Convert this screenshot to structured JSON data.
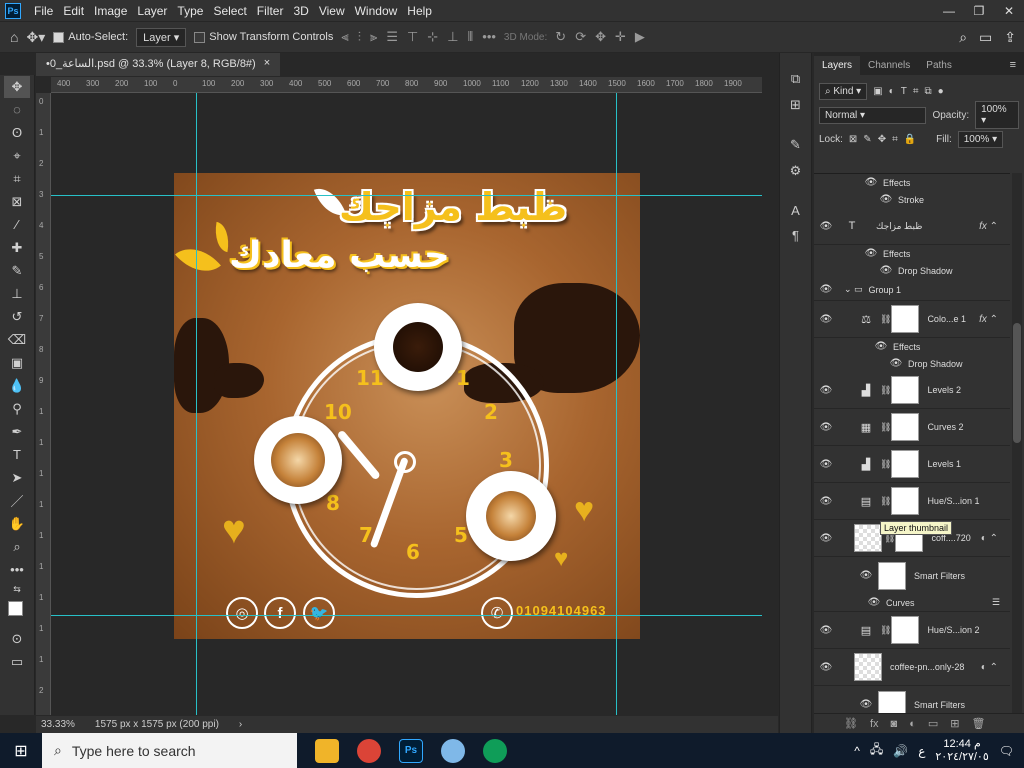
{
  "menubar": {
    "logo": "Ps",
    "items": [
      "File",
      "Edit",
      "Image",
      "Layer",
      "Type",
      "Select",
      "Filter",
      "3D",
      "View",
      "Window",
      "Help"
    ],
    "window_controls": [
      "—",
      "❐",
      "✕"
    ]
  },
  "options": {
    "auto_select_label": "Auto-Select:",
    "auto_select_target": "Layer",
    "show_transform_label": "Show Transform Controls",
    "mode_3d_label": "3D Mode:"
  },
  "document": {
    "tab_title": "•0_الساعة.psd @ 33.3% (Layer 8, RGB/8#)",
    "close": "×"
  },
  "ruler": {
    "h_ticks": [
      "400",
      "300",
      "200",
      "100",
      "0",
      "100",
      "200",
      "300",
      "400",
      "500",
      "600",
      "700",
      "800",
      "900",
      "1000",
      "1100",
      "1200",
      "1300",
      "1400",
      "1500",
      "1600",
      "1700",
      "1800",
      "1900"
    ],
    "v_ticks": [
      "0",
      "1",
      "2",
      "3",
      "4",
      "5",
      "6",
      "7",
      "8",
      "9",
      "1",
      "1",
      "1",
      "1",
      "1",
      "1",
      "1",
      "1",
      "1",
      "2"
    ]
  },
  "artwork": {
    "title_line1": "ظبط مزاجك",
    "title_line2": "حسب معادك",
    "clock_numbers": [
      "11",
      "1",
      "10",
      "2",
      "3",
      "8",
      "7",
      "6",
      "5"
    ],
    "social_icons": [
      "instagram-icon",
      "facebook-icon",
      "twitter-icon"
    ],
    "social_glyphs": [
      "◎",
      "f",
      "🐦"
    ],
    "phone_glyph": "✆",
    "phone_number": "01094104963"
  },
  "statusbar": {
    "zoom": "33.33%",
    "doc_info": "1575 px x 1575 px (200 ppi)",
    "arrow": "›"
  },
  "layers_panel": {
    "tabs": [
      "Layers",
      "Channels",
      "Paths"
    ],
    "kind_label": "Kind",
    "blend_mode": "Normal",
    "opacity_label": "Opacity:",
    "opacity_value": "100%",
    "lock_label": "Lock:",
    "fill_label": "Fill:",
    "fill_value": "100%",
    "tooltip": "Layer thumbnail",
    "rows": [
      {
        "kind": "sub",
        "eye": true,
        "name": "Effects"
      },
      {
        "kind": "sub2",
        "eye": true,
        "name": "Stroke"
      },
      {
        "kind": "layer",
        "type": "T",
        "name": "ظبط مزاجك",
        "fx": true,
        "thumb": "none"
      },
      {
        "kind": "sub",
        "eye": true,
        "name": "Effects"
      },
      {
        "kind": "sub2",
        "eye": true,
        "name": "Drop Shadow"
      },
      {
        "kind": "group",
        "name": "Group 1"
      },
      {
        "kind": "layer",
        "type": "⚖",
        "name": "Colo...e 1",
        "fx": true,
        "thumb": "white"
      },
      {
        "kind": "sub",
        "eye": true,
        "name": "Effects"
      },
      {
        "kind": "sub2",
        "eye": true,
        "name": "Drop Shadow"
      },
      {
        "kind": "layer",
        "type": "▟",
        "name": "Levels 2",
        "thumb": "white"
      },
      {
        "kind": "layer",
        "type": "▦",
        "name": "Curves 2",
        "thumb": "white"
      },
      {
        "kind": "layer",
        "type": "▟",
        "name": "Levels 1",
        "thumb": "white"
      },
      {
        "kind": "layer",
        "type": "▤",
        "name": "Hue/S...ion 1",
        "thumb": "white"
      },
      {
        "kind": "layer",
        "type": "",
        "name": "coff....720",
        "thumb": "checker"
      },
      {
        "kind": "layer",
        "type": "",
        "name": "Smart Filters",
        "thumb": "white",
        "indent": true
      },
      {
        "kind": "sub2",
        "eye": true,
        "name": "Curves"
      },
      {
        "kind": "layer",
        "type": "▤",
        "name": "Hue/S...ion 2",
        "thumb": "white"
      },
      {
        "kind": "layer",
        "type": "",
        "name": "coffee-pn...only-28",
        "thumb": "checker"
      },
      {
        "kind": "layer",
        "type": "",
        "name": "Smart Filters",
        "thumb": "white",
        "indent": true
      }
    ]
  },
  "taskbar": {
    "search_placeholder": "Type here to search",
    "time": "12:44 م",
    "date": "٢٠٢٤/٢٧/٠٥",
    "lang": "ع"
  },
  "colors": {
    "accent": "#31a8ff",
    "guide": "#27c1c8",
    "art_yellow": "#f5c01c"
  }
}
